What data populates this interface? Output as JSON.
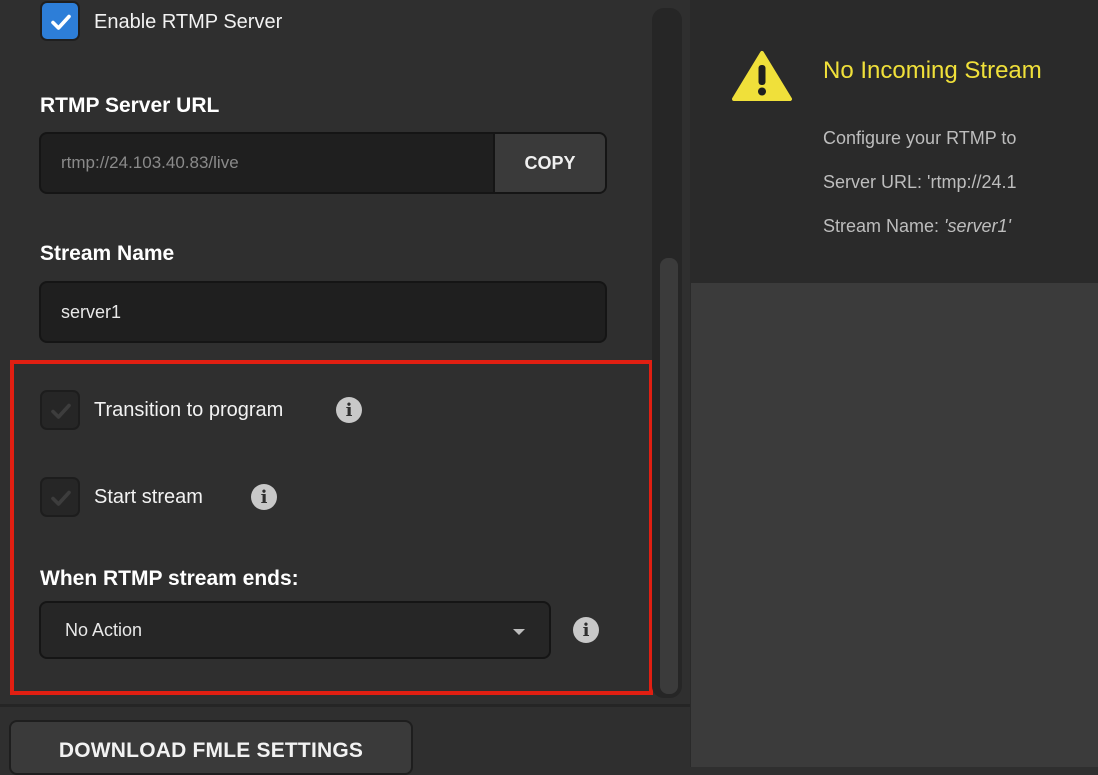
{
  "settings": {
    "enable_rtmp_label": "Enable RTMP Server",
    "enable_rtmp_checked": true,
    "server_url_label": "RTMP Server URL",
    "server_url_value": "rtmp://24.103.40.83/live",
    "copy_button_label": "COPY",
    "stream_name_label": "Stream Name",
    "stream_name_value": "server1",
    "transition_label": "Transition to program",
    "start_stream_label": "Start stream",
    "ends_label": "When RTMP stream ends:",
    "ends_select_value": "No Action",
    "download_button_label": "DOWNLOAD FMLE SETTINGS"
  },
  "alert": {
    "title": "No Incoming Stream",
    "line1": "Configure your RTMP to",
    "line2": "Server URL: 'rtmp://24.1",
    "line3_prefix": "Stream Name: ",
    "line3_value": "'server1'"
  },
  "colors": {
    "accent": "#2d7ed8",
    "highlight_frame": "#e11f12",
    "alert_title": "#f0e03a"
  },
  "icons": {
    "checkbox_check": "check-icon",
    "info": "info-icon",
    "warning": "warning-icon",
    "dropdown": "chevron-down-icon"
  }
}
